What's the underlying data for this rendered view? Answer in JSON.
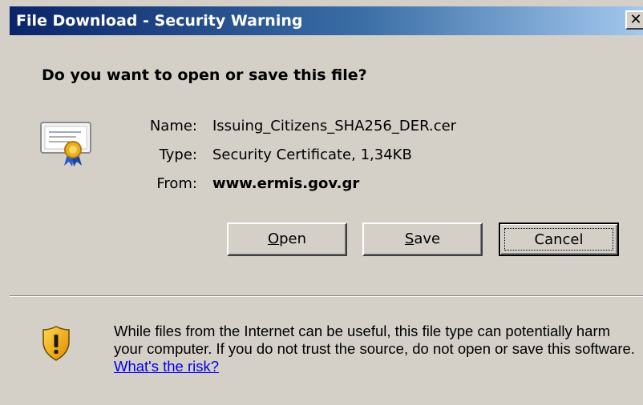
{
  "window": {
    "title": "File Download - Security Warning",
    "close_symbol": "✕"
  },
  "dialog": {
    "question": "Do you want to open or save this file?",
    "icon": "certificate-icon",
    "fields": {
      "name_label": "Name:",
      "name_value": "Issuing_Citizens_SHA256_DER.cer",
      "type_label": "Type:",
      "type_value": "Security Certificate, 1,34KB",
      "from_label": "From:",
      "from_value": "www.ermis.gov.gr"
    },
    "buttons": {
      "open_accel": "O",
      "open_rest": "pen",
      "save_accel": "S",
      "save_rest": "ave",
      "cancel": "Cancel"
    }
  },
  "warning": {
    "icon": "shield-warning-icon",
    "text": "While files from the Internet can be useful, this file type can potentially harm your computer. If you do not trust the source, do not open or save this software. ",
    "link": "What's the risk?"
  },
  "colors": {
    "dialog_bg": "#d4d0c8",
    "title_gradient_start": "#0a246a",
    "title_gradient_end": "#a6caf0",
    "link": "#0000ee"
  }
}
